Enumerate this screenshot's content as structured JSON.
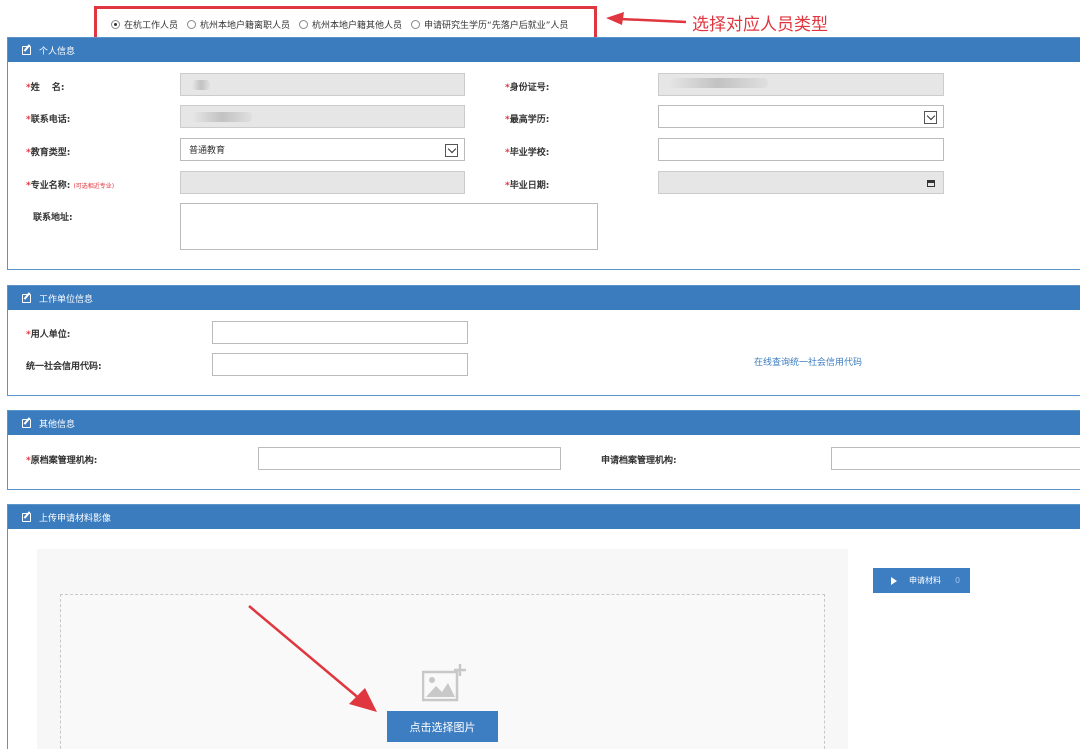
{
  "person_type": {
    "options": [
      "在杭工作人员",
      "杭州本地户籍离职人员",
      "杭州本地户籍其他人员",
      "申请研究生学历“先落户后就业”人员"
    ],
    "selected_index": 0
  },
  "annotation": {
    "text": "选择对应人员类型",
    "color": "#e0363f"
  },
  "personal": {
    "title": "个人信息",
    "name_label": "姓　 名:",
    "id_label": "身份证号:",
    "phone_label": "联系电话:",
    "degree_label": "最高学历:",
    "degree_value": "",
    "edu_type_label": "教育类型:",
    "edu_type_value": "普通教育",
    "school_label": "毕业学校:",
    "school_value": "",
    "major_label": "专业名称:",
    "major_hint": "(可选相近专业)",
    "grad_date_label": "毕业日期:",
    "address_label": "联系地址:"
  },
  "employer": {
    "title": "工作单位信息",
    "unit_label": "用人单位:",
    "credit_label": "统一社会信用代码:",
    "credit_link": "在线查询统一社会信用代码"
  },
  "other": {
    "title": "其他信息",
    "orig_archive_label": "原档案管理机构:",
    "apply_archive_label": "申请档案管理机构:"
  },
  "upload": {
    "title": "上传申请材料影像",
    "choose_button": "点击选择图片",
    "materials_button": "申请材料",
    "materials_count": "0"
  },
  "colors": {
    "panel_header": "#3b7cbf",
    "required": "#e0363f",
    "button": "#3d7ec2"
  }
}
